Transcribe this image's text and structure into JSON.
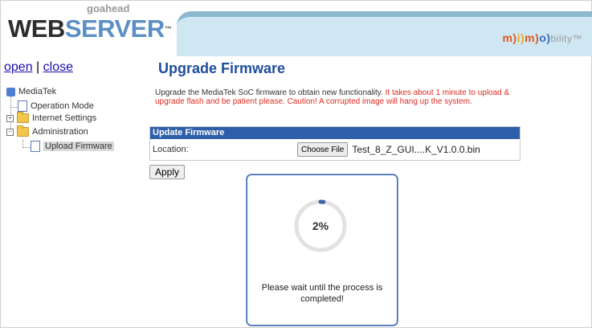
{
  "header": {
    "logo_sub": "goahead",
    "logo_web": "WEB",
    "logo_server": "SERVER",
    "logo_tm": "™",
    "brand_m": "m)",
    "brand_i": "i)",
    "brand_m2": "m)",
    "brand_o": "o)",
    "brand_rest": "bility™"
  },
  "nav_toggle": {
    "open": "open",
    "sep": "|",
    "close": "close"
  },
  "tree": {
    "root": "MediaTek",
    "operation_mode": "Operation Mode",
    "internet_settings": "Internet Settings",
    "administration": "Administration",
    "upload_firmware": "Upload Firmware"
  },
  "main": {
    "title": "Upgrade Firmware",
    "desc_normal": "Upgrade the MediaTek SoC firmware to obtain new functionality.",
    "desc_warn": "It takes about 1 minute to upload & upgrade flash and be patient please. Caution! A corrupted image will hang up the system.",
    "table_header": "Update Firmware",
    "location_label": "Location:",
    "choose_file": "Choose File",
    "file_name": "Test_8_Z_GUI....K_V1.0.0.bin",
    "apply": "Apply"
  },
  "modal": {
    "progress_text": "2%",
    "progress_value": 0.02,
    "message": "Please wait until the process is completed!"
  },
  "colors": {
    "title": "#1e4e9c",
    "warning": "#e02b20",
    "table_header_bg": "#2f5fa8",
    "banner_bg": "#cfe7f3"
  }
}
